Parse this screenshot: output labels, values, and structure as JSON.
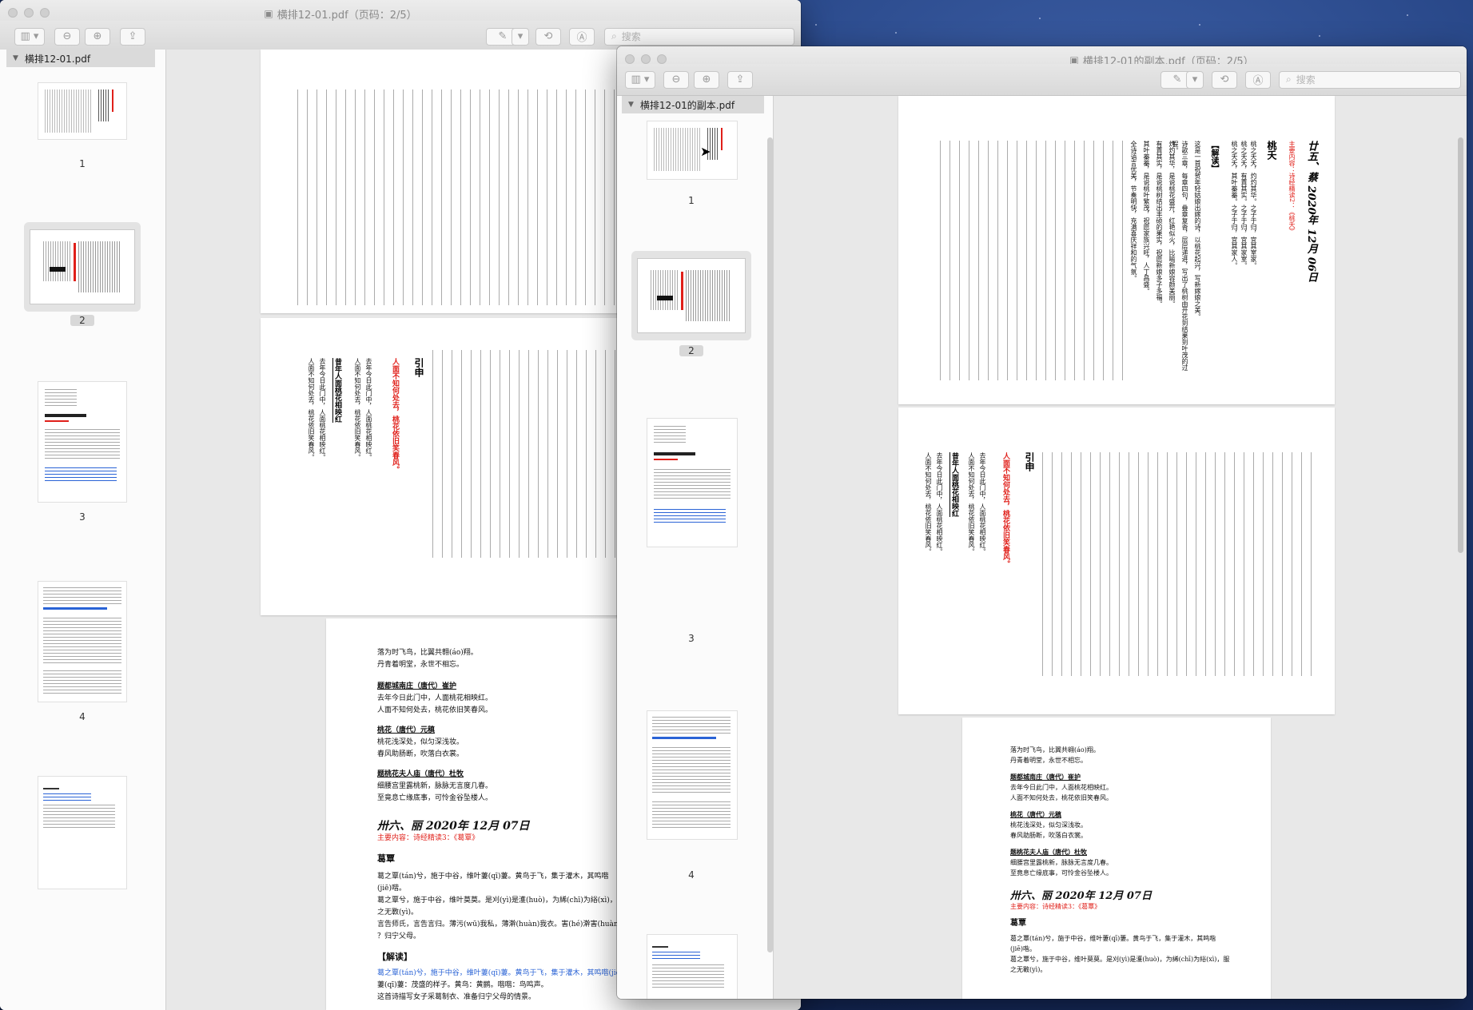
{
  "back_window": {
    "title": "横排12-01.pdf（页码：2/5）",
    "sidebar_header": "横排12-01.pdf",
    "search_placeholder": "搜索",
    "thumbs": [
      "1",
      "2",
      "3",
      "4",
      ""
    ]
  },
  "front_window": {
    "title": "横排12-01的副本.pdf（页码：2/5）",
    "sidebar_header": "横排12-01的副本.pdf",
    "search_placeholder": "搜索",
    "thumbs": [
      "1",
      "2",
      "3",
      "4",
      ""
    ]
  },
  "page_text": {
    "heading_vertical": "廿五、蔡 2020年 12月 06日",
    "subtitle_vertical": "主要内容：诗经精读2：《桃夭》",
    "section_taoyao": "桃夭",
    "jiedu": "【解读】",
    "yinshen": "引申",
    "poem_lines": [
      "桃之夭夭，灼灼其华。之子于归，宜其室家。",
      "桃之夭夭，有蕡其实。之子于归，宜其家室。",
      "桃之夭夭，其叶蓁蓁。之子于归，宜其家人。"
    ],
    "para_lines": [
      "这是一首祝贺年轻姑娘出嫁的诗，以桃花起兴，写新嫁娘之美。",
      "诗歌三章，每章四句，叠章复沓，层层递进，写出了桃树由开花到结果到叶茂的过程。",
      "灼灼其华，是说桃花盛开，红艳似火，比喻新娘容颜美丽。",
      "有蕡其实，是说桃树结出丰硕的果实，祝愿新娘多子多福。",
      "其叶蓁蓁，是说桃叶繁茂，祝愿家族兴旺，人丁昌盛。",
      "全诗语言优美，节奏明快，充满喜庆祥和的气氛。"
    ],
    "red_line_vertical": "人面不知何处去，桃花依旧笑春风。",
    "poem_small": [
      "昔年人面桃花相映红",
      "去年今日此门中，人面桃花相映红。",
      "人面不知何处去，桃花依旧笑春风。"
    ],
    "lower_block": {
      "lines_top": [
        "落为时飞鸟，比翼共翱(áo)翔。",
        "丹青着明堂，永世不相忘。"
      ],
      "h1": "题都城南庄（唐代）崔护",
      "h1_lines": [
        "去年今日此门中，人面桃花相映红。",
        "人面不知何处去，桃花依旧笑春风。"
      ],
      "h2": "桃花（唐代）元稹",
      "h2_lines": [
        "桃花浅深处，似匀深浅妆。",
        "春风助肠断，吹落白衣裳。"
      ],
      "h3": "题桃花夫人庙（唐代）杜牧",
      "h3_lines": [
        "细腰宫里露桃新，脉脉无言度几春。",
        "至竟息亡缘底事，可怜金谷坠楼人。"
      ],
      "title": "卅六、丽 2020年 12月 07日",
      "subtitle": "主要内容：诗经精读3：《葛覃》",
      "section": "葛覃",
      "body": [
        "葛之覃(tán)兮，施于中谷，维叶萋(qī)萋。黄鸟于飞，集于灌木，其鸣喈",
        "(jiē)喈。",
        "葛之覃兮，施于中谷，维叶莫莫。是刈(yì)是濩(huò)，为絺(chī)为綌(xì)，服",
        "之无斁(yì)。",
        "言告师氏，言告言归。薄污(wū)我私，薄澣(huàn)我衣。害(hé)澣害(huàn)否(fǒu)",
        "？归宁父母。"
      ],
      "jiedu": "【解读】",
      "blue_line": "葛之覃(tán)兮，施于中谷，维叶萋(qī)萋。黄鸟于飞，集于灌木，其鸣喈(jiē)喈。",
      "tail": [
        "萋(qī)萋：茂盛的样子。黄鸟：黄鹂。喈喈：鸟鸣声。",
        "这首诗描写女子采葛制衣、准备归宁父母的情景。"
      ]
    }
  },
  "colors": {
    "accent_red": "#e0201a",
    "link_blue": "#2a63d6",
    "desktop": "#1b3470"
  },
  "icons": [
    "sidebar-toggle-icon",
    "zoom-out-icon",
    "zoom-in-icon",
    "share-icon",
    "pen-icon",
    "chevron-down-icon",
    "rotate-icon",
    "markup-icon",
    "search-icon",
    "disclosure-triangle-icon",
    "cursor-icon"
  ]
}
